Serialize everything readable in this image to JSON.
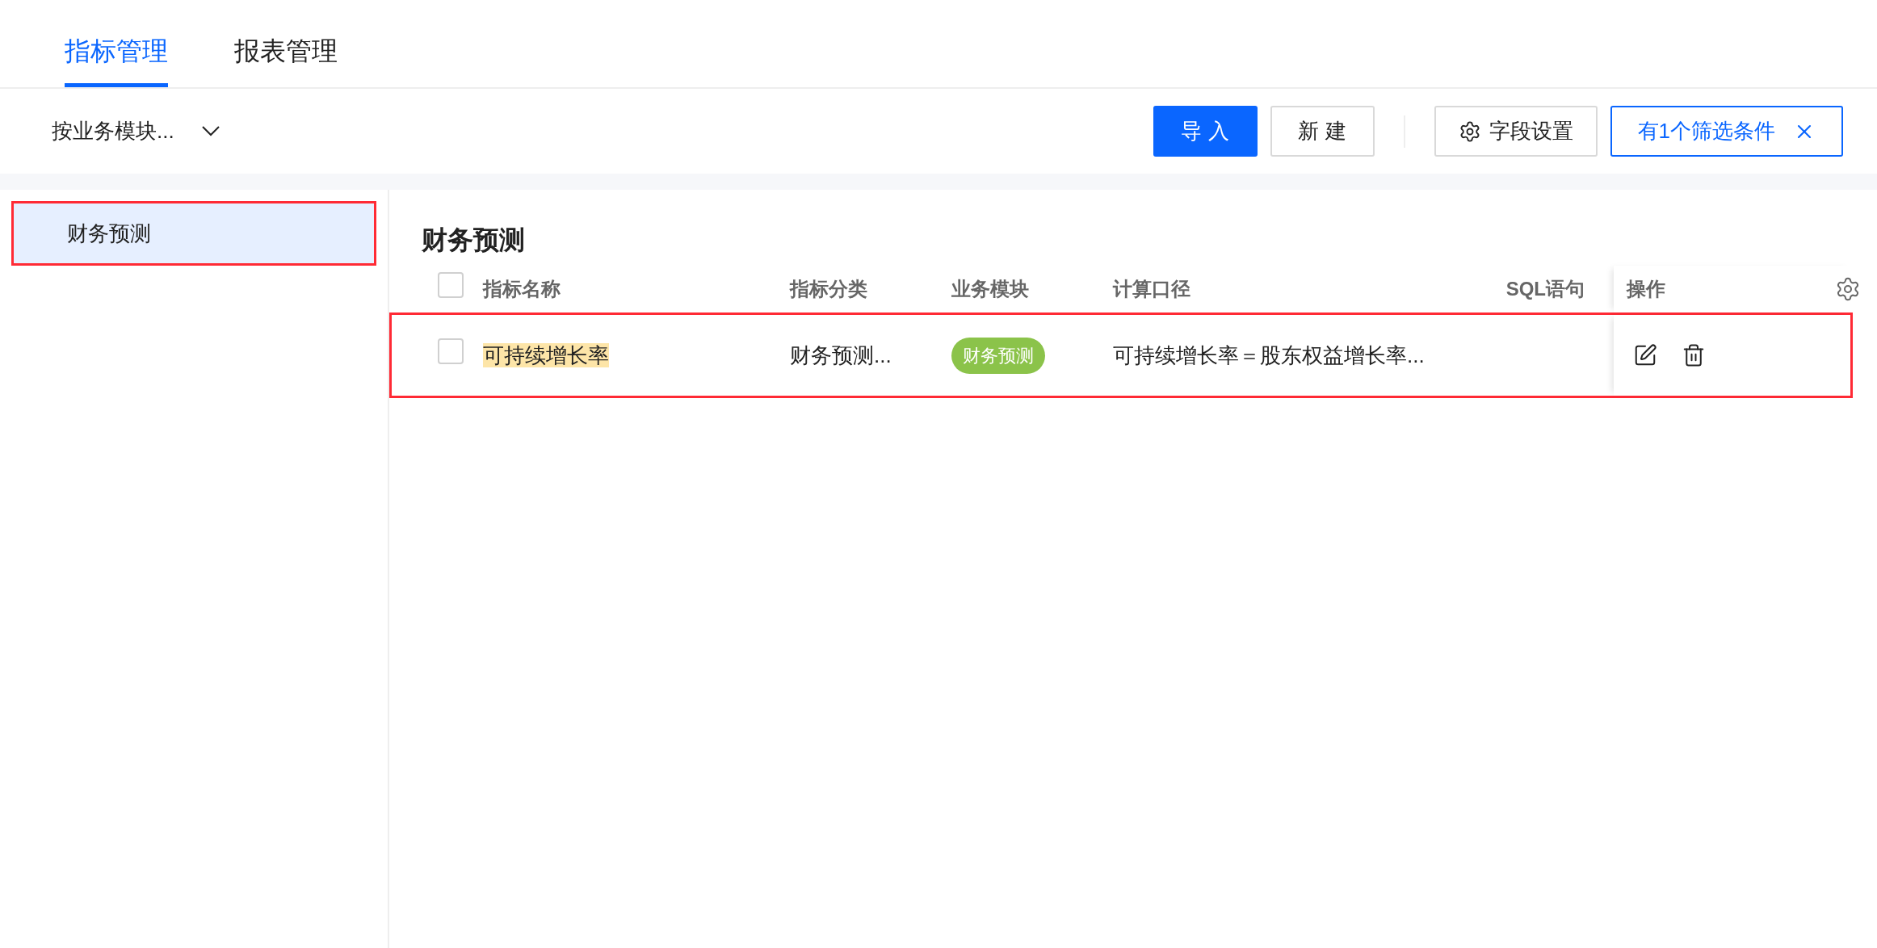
{
  "tabs": [
    {
      "label": "指标管理",
      "selected": true
    },
    {
      "label": "报表管理",
      "selected": false
    }
  ],
  "toolbar": {
    "group_select": {
      "value": "按业务模块..."
    },
    "buttons": [
      {
        "kind": "primary",
        "label": "导 入"
      },
      {
        "kind": "default",
        "label": "新 建"
      },
      {
        "kind": "divider"
      },
      {
        "kind": "settings",
        "label": "字段设置"
      },
      {
        "kind": "filter",
        "label": "有1个筛选条件"
      }
    ]
  },
  "sidebar": {
    "items": [
      {
        "label": "财务预测",
        "selected": true,
        "highlighted": true
      }
    ]
  },
  "table": {
    "title": "财务预测",
    "columns": [
      "指标名称",
      "指标分类",
      "业务模块",
      "计算口径",
      "SQL语句",
      "操作"
    ],
    "header_checkbox": {
      "checked": false
    },
    "rows": [
      {
        "checked": false,
        "highlighted": true,
        "name": "可持续增长率",
        "category": "财务预测...",
        "module": "财务预测",
        "formula": "可持续增长率＝股东权益增长率...",
        "sql": ""
      }
    ]
  }
}
